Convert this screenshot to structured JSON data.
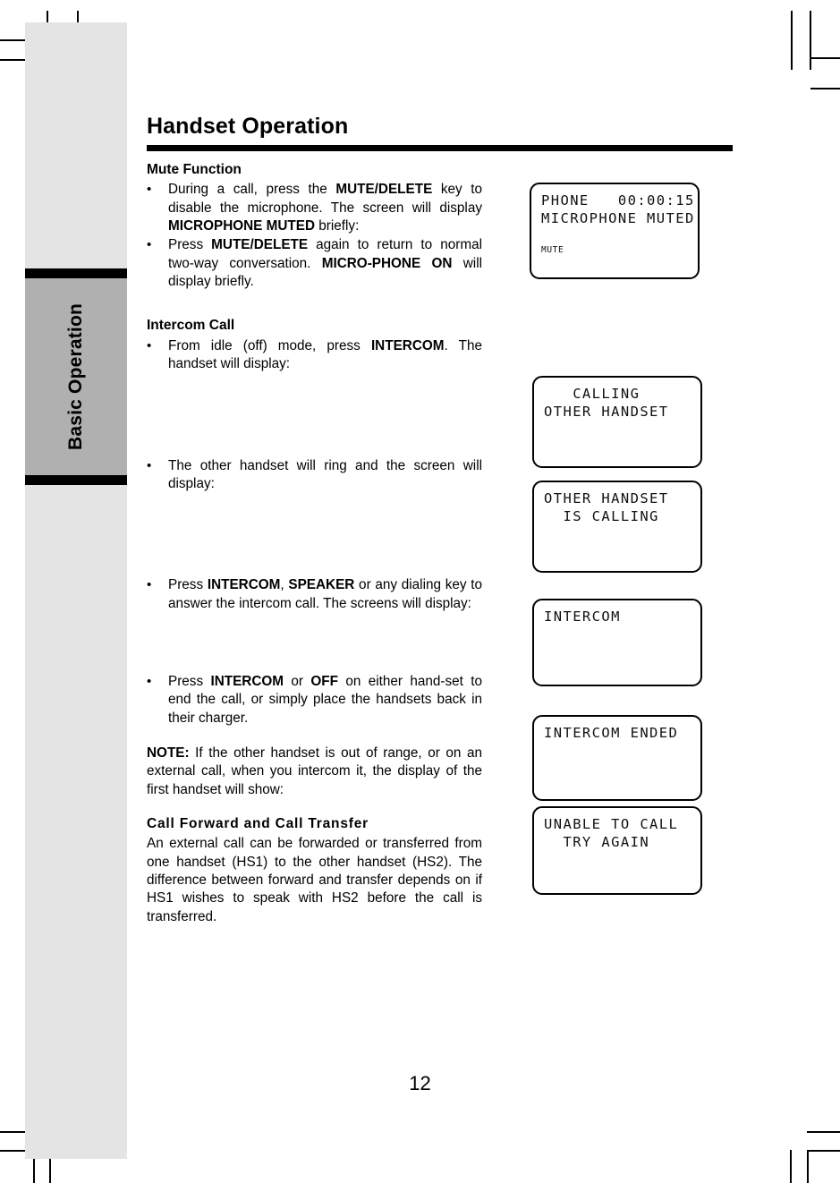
{
  "side_tab": {
    "label": "Basic Operation"
  },
  "header": {
    "title": "Handset Operation"
  },
  "page": {
    "number": "12"
  },
  "sections": {
    "mute": {
      "heading": "Mute Function",
      "bullet_glyph": "•",
      "bullets": [
        {
          "parts": [
            {
              "t": "During a call, press the ",
              "b": false
            },
            {
              "t": "MUTE/DELETE",
              "b": true
            },
            {
              "t": " key to disable the microphone. The screen will display ",
              "b": false
            },
            {
              "t": "MICROPHONE MUTED",
              "b": true
            },
            {
              "t": " briefly:",
              "b": false
            }
          ]
        },
        {
          "parts": [
            {
              "t": "Press ",
              "b": false
            },
            {
              "t": "MUTE/DELETE",
              "b": true
            },
            {
              "t": " again to return to normal two-way conversation. ",
              "b": false
            },
            {
              "t": "MICRO-PHONE ON",
              "b": true
            },
            {
              "t": " will display briefly.",
              "b": false
            }
          ]
        }
      ]
    },
    "intercom": {
      "heading": "Intercom Call",
      "bullets": [
        {
          "parts": [
            {
              "t": "From idle (off) mode, press ",
              "b": false
            },
            {
              "t": "INTERCOM",
              "b": true
            },
            {
              "t": ". The handset will display:",
              "b": false
            }
          ]
        },
        {
          "parts": [
            {
              "t": "The other handset will ring and the screen will display:",
              "b": false
            }
          ]
        },
        {
          "parts": [
            {
              "t": "Press ",
              "b": false
            },
            {
              "t": "INTERCOM",
              "b": true
            },
            {
              "t": ", ",
              "b": false
            },
            {
              "t": "SPEAKER",
              "b": true
            },
            {
              "t": " or any dialing key to answer the intercom call. The screens will display:",
              "b": false
            }
          ]
        },
        {
          "parts": [
            {
              "t": "Press ",
              "b": false
            },
            {
              "t": "INTERCOM",
              "b": true
            },
            {
              "t": " or ",
              "b": false
            },
            {
              "t": "OFF",
              "b": true
            },
            {
              "t": " on either hand-set to end the call, or simply place the handsets back in their charger.",
              "b": false
            }
          ]
        }
      ],
      "note": {
        "parts": [
          {
            "t": "NOTE:",
            "b": true
          },
          {
            "t": " If the other handset is out of range, or on an external call, when you intercom it, the display of the first handset will show:",
            "b": false
          }
        ]
      }
    },
    "call_forward": {
      "heading": "Call Forward and Call Transfer",
      "body": "An external call can be forwarded or transferred from one handset (HS1) to the other handset (HS2). The difference between forward and transfer depends on if HS1 wishes to speak with HS2 before the call is transferred."
    }
  },
  "lcd_screens": [
    {
      "name": "microphone-muted",
      "lines": [
        {
          "text": "PHONE   00:00:15",
          "align": "left",
          "size": "normal"
        },
        {
          "text": "MICROPHONE MUTED",
          "align": "left",
          "size": "normal"
        },
        {
          "text": "",
          "align": "left",
          "size": "normal"
        },
        {
          "text": "MUTE",
          "align": "left",
          "size": "small"
        }
      ]
    },
    {
      "name": "calling-other-handset",
      "lines": [
        {
          "text": "   CALLING",
          "align": "left",
          "size": "normal"
        },
        {
          "text": "OTHER HANDSET",
          "align": "left",
          "size": "normal"
        }
      ]
    },
    {
      "name": "other-handset-is-calling",
      "lines": [
        {
          "text": "OTHER HANDSET",
          "align": "left",
          "size": "normal"
        },
        {
          "text": "  IS CALLING",
          "align": "left",
          "size": "normal"
        }
      ]
    },
    {
      "name": "intercom",
      "lines": [
        {
          "text": "INTERCOM",
          "align": "left",
          "size": "normal"
        }
      ]
    },
    {
      "name": "intercom-ended",
      "lines": [
        {
          "text": "INTERCOM ENDED",
          "align": "left",
          "size": "normal"
        }
      ]
    },
    {
      "name": "unable-to-call",
      "lines": [
        {
          "text": "UNABLE TO CALL",
          "align": "left",
          "size": "normal"
        },
        {
          "text": "  TRY AGAIN",
          "align": "left",
          "size": "normal"
        }
      ]
    }
  ]
}
